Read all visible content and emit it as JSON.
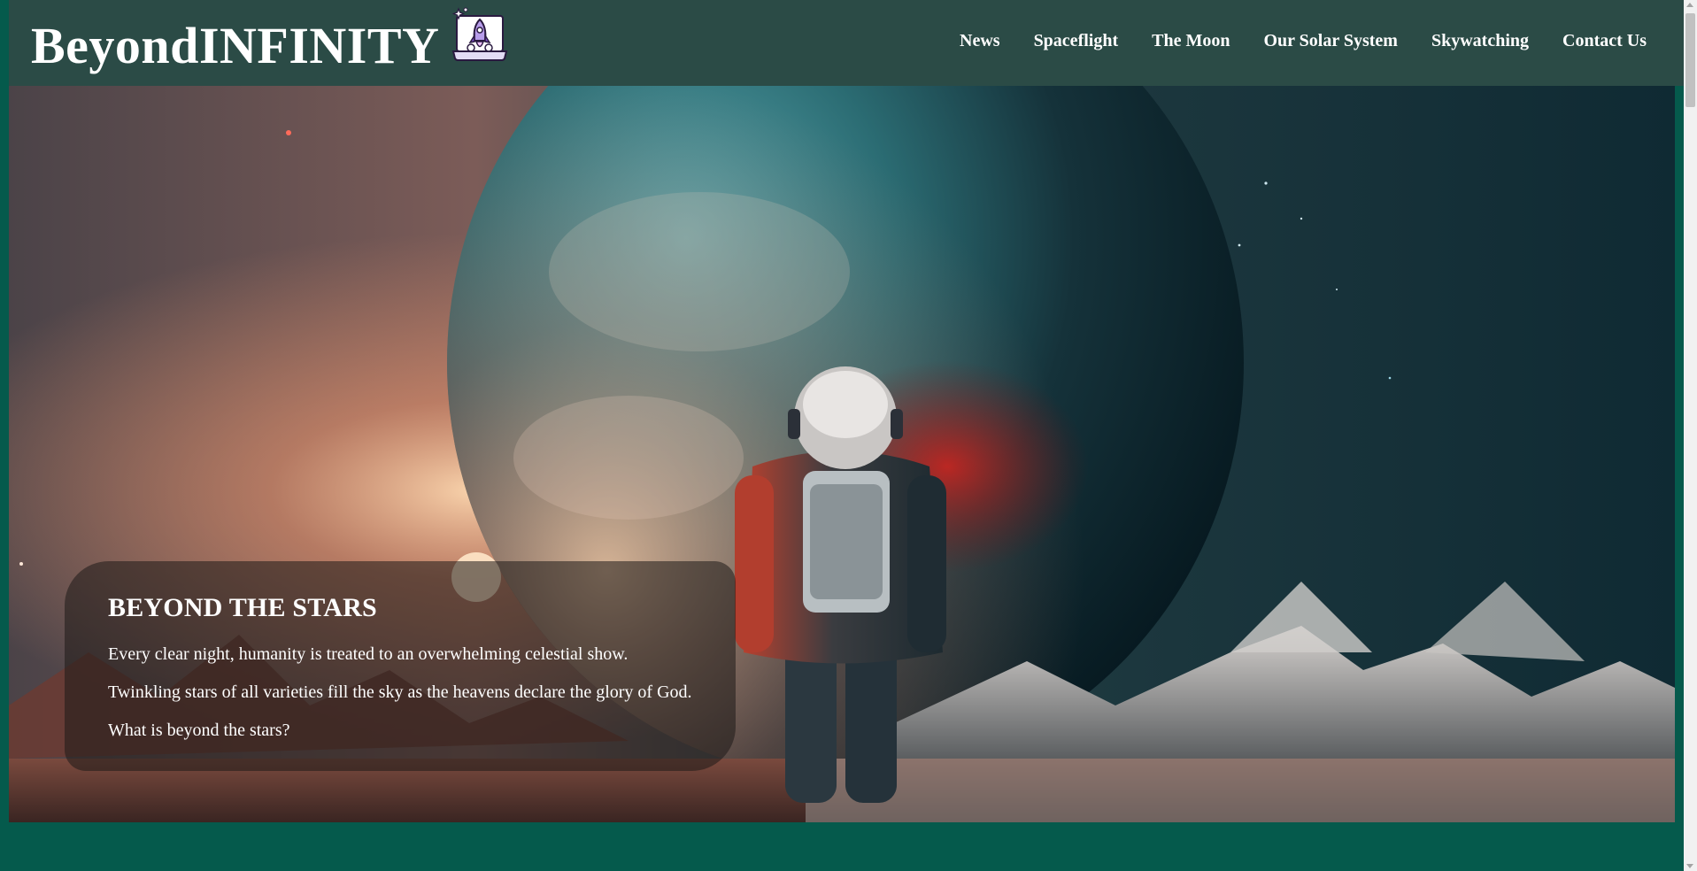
{
  "brand": {
    "title": "BeyondINFINITY",
    "logo_icon": "rocket-launch-laptop-icon"
  },
  "nav": {
    "items": [
      {
        "label": "News"
      },
      {
        "label": "Spaceflight"
      },
      {
        "label": "The Moon"
      },
      {
        "label": "Our Solar System"
      },
      {
        "label": "Skywatching"
      },
      {
        "label": "Contact Us"
      }
    ]
  },
  "hero": {
    "heading": "BEYOND THE STARS",
    "paragraphs": [
      "Every clear night, humanity is treated to an overwhelming celestial show.",
      "Twinkling stars of all varieties fill the sky as the heavens declare the glory of God.",
      "What is beyond the stars?"
    ]
  },
  "colors": {
    "page_background": "#055a4c",
    "header_background": "#2b4b46",
    "text": "#ffffff",
    "logo_accent": "#7d4fc4"
  }
}
